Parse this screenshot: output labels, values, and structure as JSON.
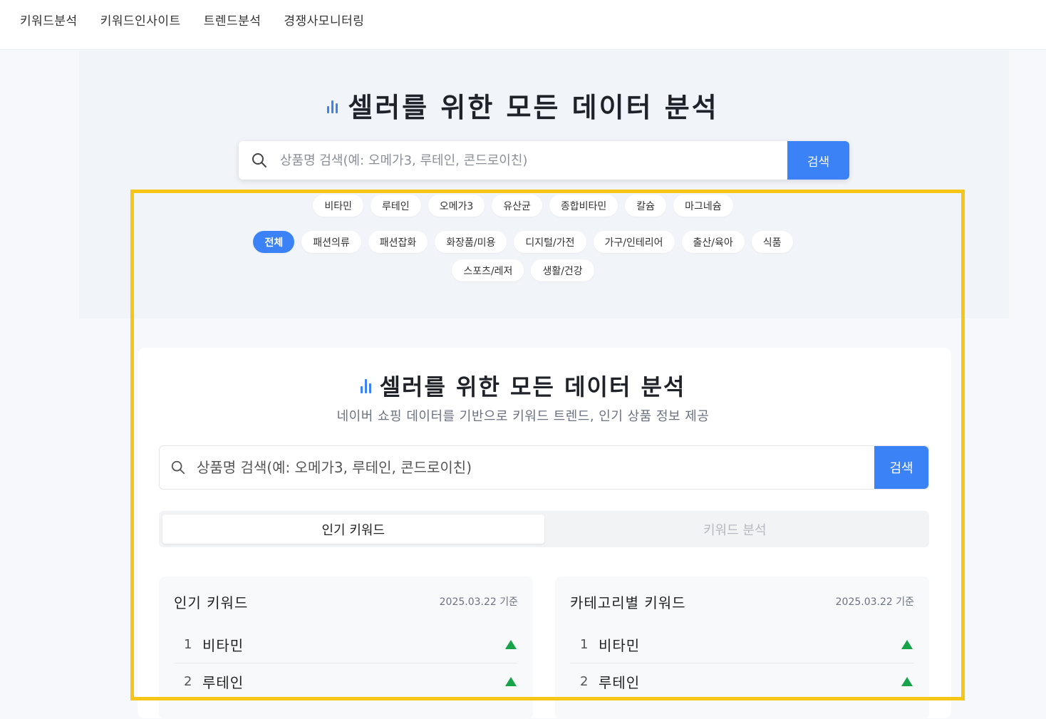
{
  "nav": [
    "키워드분석",
    "키워드인사이트",
    "트렌드분석",
    "경쟁사모니터링"
  ],
  "hero": {
    "title": "셀러를 위한 모든 데이터 분석",
    "search_placeholder": "상품명 검색(예: 오메가3, 루테인, 콘드로이친)",
    "search_button": "검색",
    "keyword_chips": [
      "비타민",
      "루테인",
      "오메가3",
      "유산균",
      "종합비타민",
      "칼슘",
      "마그네슘"
    ],
    "category_chips": [
      "전체",
      "패션의류",
      "패션잡화",
      "화장품/미용",
      "디지털/가전",
      "가구/인테리어",
      "출산/육아",
      "식품"
    ],
    "category_chips_row2": [
      "스포츠/레저",
      "생활/건강"
    ],
    "active_category": "전체"
  },
  "card": {
    "title": "셀러를 위한 모든 데이터 분석",
    "subtitle": "네이버 쇼핑 데이터를 기반으로 키워드 트렌드, 인기 상품 정보 제공",
    "search_placeholder": "상품명 검색(예: 오메가3, 루테인, 콘드로이친)",
    "search_button": "검색",
    "tabs": [
      {
        "label": "인기 키워드",
        "active": true
      },
      {
        "label": "키워드 분석",
        "active": false
      }
    ]
  },
  "panels": [
    {
      "title": "인기 키워드",
      "date": "2025.03.22 기준",
      "rows": [
        {
          "rank": "1",
          "name": "비타민",
          "trend": "up"
        },
        {
          "rank": "2",
          "name": "루테인",
          "trend": "up"
        }
      ]
    },
    {
      "title": "카테고리별 키워드",
      "date": "2025.03.22 기준",
      "rows": [
        {
          "rank": "1",
          "name": "비타민",
          "trend": "up"
        },
        {
          "rank": "2",
          "name": "루테인",
          "trend": "up"
        }
      ]
    }
  ],
  "colors": {
    "accent": "#3b82f6",
    "trend_up": "#16a34a",
    "highlight": "#f5c518"
  }
}
